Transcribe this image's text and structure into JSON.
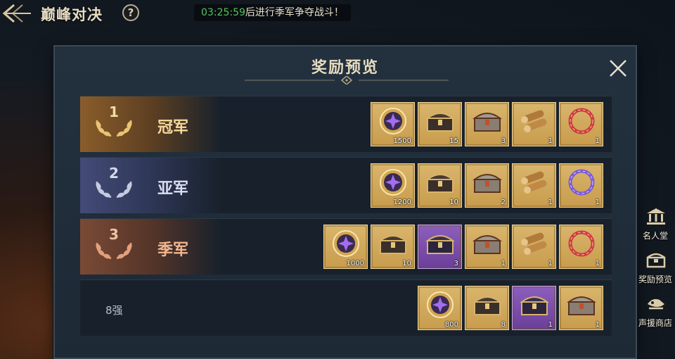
{
  "header": {
    "title": "巅峰对决",
    "help": "?",
    "timer": "03:25:59",
    "timer_message": "后进行季军争夺战斗！"
  },
  "panel": {
    "title": "奖励预览",
    "close": "×",
    "rows": [
      {
        "rank_number": "1",
        "label": "冠军",
        "items": [
          {
            "icon": "star-coin-icon",
            "qty": "1500",
            "bg": "gold"
          },
          {
            "icon": "dark-chest-icon",
            "qty": "15",
            "bg": "gold"
          },
          {
            "icon": "silver-chest-icon",
            "qty": "3",
            "bg": "gold"
          },
          {
            "icon": "wood-logs-icon",
            "qty": "1",
            "bg": "gold"
          },
          {
            "icon": "red-ring-icon",
            "qty": "1",
            "bg": "gold"
          }
        ]
      },
      {
        "rank_number": "2",
        "label": "亚军",
        "items": [
          {
            "icon": "star-coin-icon",
            "qty": "1200",
            "bg": "gold"
          },
          {
            "icon": "dark-chest-icon",
            "qty": "10",
            "bg": "gold"
          },
          {
            "icon": "silver-chest-icon",
            "qty": "2",
            "bg": "gold"
          },
          {
            "icon": "wood-logs-icon",
            "qty": "1",
            "bg": "gold"
          },
          {
            "icon": "purple-ring-icon",
            "qty": "1",
            "bg": "gold"
          }
        ]
      },
      {
        "rank_number": "3",
        "label": "季军",
        "items": [
          {
            "icon": "star-coin-icon",
            "qty": "1000",
            "bg": "gold"
          },
          {
            "icon": "dark-chest-icon",
            "qty": "10",
            "bg": "gold"
          },
          {
            "icon": "dark-chest-icon",
            "qty": "3",
            "bg": "purple"
          },
          {
            "icon": "silver-chest-icon",
            "qty": "1",
            "bg": "gold"
          },
          {
            "icon": "wood-logs-icon",
            "qty": "1",
            "bg": "gold"
          },
          {
            "icon": "red-ring-icon",
            "qty": "1",
            "bg": "gold"
          }
        ]
      },
      {
        "rank_number": "",
        "label": "8强",
        "items": [
          {
            "icon": "star-coin-icon",
            "qty": "800",
            "bg": "gold"
          },
          {
            "icon": "dark-chest-icon",
            "qty": "8",
            "bg": "gold"
          },
          {
            "icon": "dark-chest-icon",
            "qty": "1",
            "bg": "purple"
          },
          {
            "icon": "silver-chest-icon",
            "qty": "1",
            "bg": "gold"
          }
        ]
      }
    ]
  },
  "side_menu": [
    {
      "icon": "hall-icon",
      "label": "名人堂"
    },
    {
      "icon": "reward-icon",
      "label": "奖励预览"
    },
    {
      "icon": "shop-icon",
      "label": "声援商店"
    }
  ],
  "colors": {
    "accent_gold": "#d9b56c",
    "item_purple": "#8d5fbd",
    "timer_green": "#57c25d"
  }
}
